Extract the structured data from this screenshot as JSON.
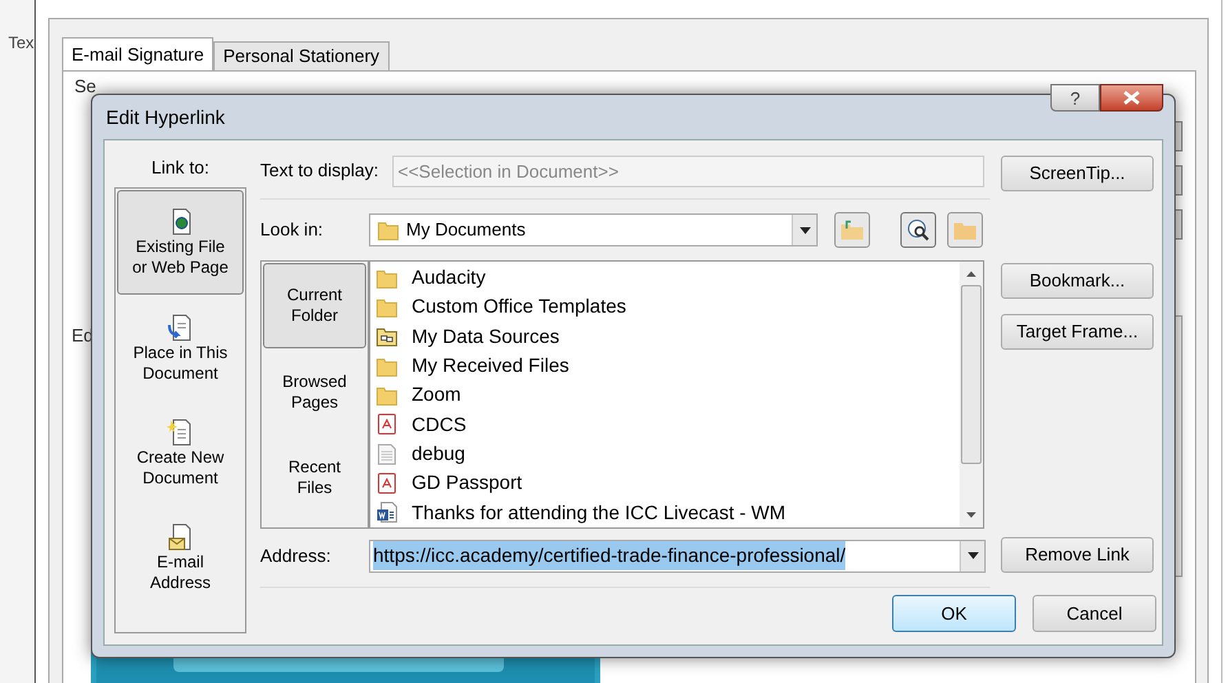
{
  "background": {
    "cut_label": "Tex",
    "tabs": [
      {
        "label": "E-mail Signature",
        "selected": true
      },
      {
        "label": "Personal Stationery",
        "selected": false
      }
    ],
    "cut_labels": [
      "Se",
      "Ed"
    ]
  },
  "dialog": {
    "title": "Edit Hyperlink",
    "help": "?",
    "link_to_label": "Link to:",
    "link_to": [
      {
        "label": "Existing File\nor Web Page",
        "kind": "file",
        "selected": true
      },
      {
        "label": "Place in This\nDocument",
        "kind": "place",
        "selected": false
      },
      {
        "label": "Create New\nDocument",
        "kind": "new",
        "selected": false
      },
      {
        "label": "E-mail\nAddress",
        "kind": "email",
        "selected": false
      }
    ],
    "text_to_display": {
      "label": "Text to display:",
      "value": "<<Selection in Document>>",
      "disabled": true
    },
    "look_in": {
      "label": "Look in:",
      "value": "My Documents"
    },
    "nav": [
      {
        "label": "Current\nFolder",
        "selected": true
      },
      {
        "label": "Browsed\nPages",
        "selected": false
      },
      {
        "label": "Recent\nFiles",
        "selected": false
      }
    ],
    "files": [
      {
        "name": "Audacity",
        "kind": "folder"
      },
      {
        "name": "Custom Office Templates",
        "kind": "folder"
      },
      {
        "name": "My Data Sources",
        "kind": "datasource"
      },
      {
        "name": "My Received Files",
        "kind": "folder"
      },
      {
        "name": "Zoom",
        "kind": "folder"
      },
      {
        "name": "CDCS",
        "kind": "pdf"
      },
      {
        "name": "debug",
        "kind": "text"
      },
      {
        "name": "GD Passport",
        "kind": "pdf"
      },
      {
        "name": "Thanks for attending the ICC Livecast - WM",
        "kind": "word"
      }
    ],
    "address": {
      "label": "Address:",
      "value": "https://icc.academy/certified-trade-finance-professional/",
      "highlighted": true
    },
    "side_buttons": [
      "ScreenTip...",
      "Bookmark...",
      "Target Frame...",
      "Remove Link"
    ],
    "footer_buttons": [
      {
        "label": "OK",
        "default": true
      },
      {
        "label": "Cancel",
        "default": false
      }
    ]
  }
}
